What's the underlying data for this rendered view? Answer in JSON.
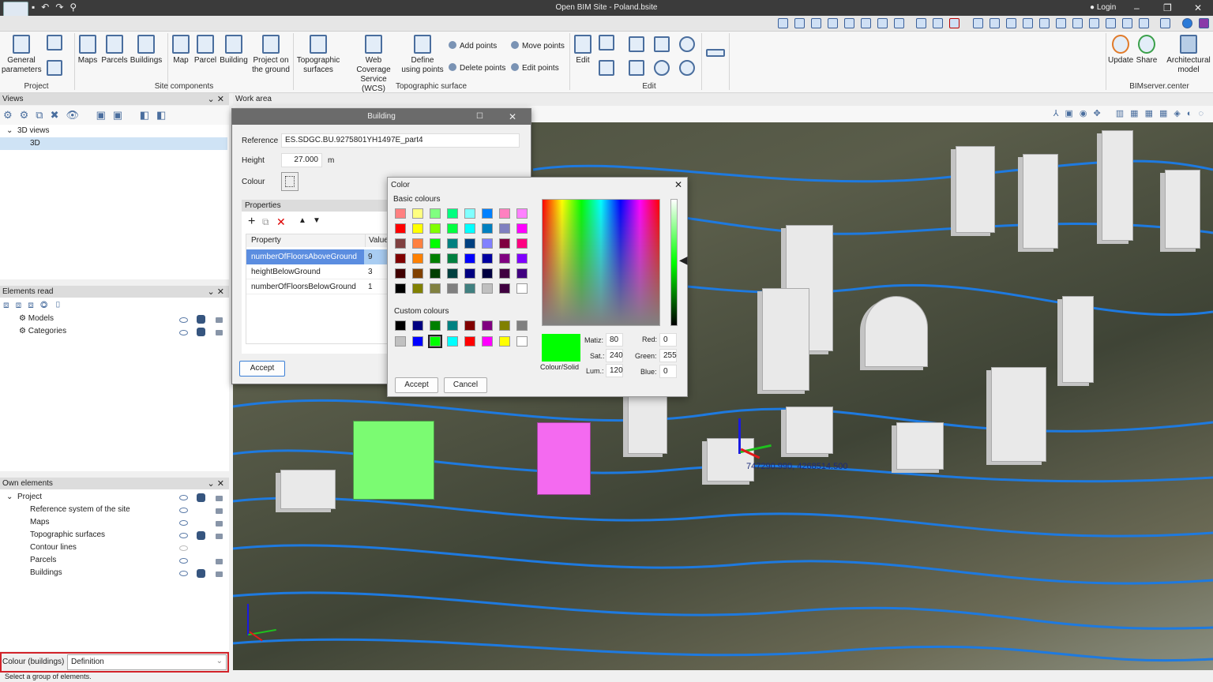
{
  "app": {
    "title": "Open BIM Site - Poland.bsite",
    "login": "Login",
    "minimize": "–",
    "restore": "❐",
    "close": "✕"
  },
  "ribbon": {
    "project": {
      "general_parameters": "General parameters",
      "group": "Project"
    },
    "site": {
      "maps": "Maps",
      "parcels": "Parcels",
      "buildings": "Buildings",
      "map": "Map",
      "parcel": "Parcel",
      "building": "Building",
      "project_on_ground": "Project on the ground",
      "group": "Site components"
    },
    "topo": {
      "topographic_surfaces": "Topographic surfaces",
      "wcs": "Web Coverage Service (WCS)",
      "define_points": "Define using points",
      "add_points": "Add points",
      "move_points": "Move points",
      "delete_points": "Delete points",
      "edit_points": "Edit points",
      "group": "Topographic surface"
    },
    "edit": {
      "edit": "Edit",
      "group": "Edit"
    },
    "bim": {
      "update": "Update",
      "share": "Share",
      "architectural_model": "Architectural model",
      "group": "BIMserver.center"
    }
  },
  "views": {
    "title": "Views",
    "tree": [
      {
        "label": "3D views"
      },
      {
        "label": "3D",
        "selected": true
      }
    ]
  },
  "elements_read": {
    "title": "Elements read",
    "items": [
      {
        "label": "Models"
      },
      {
        "label": "Categories"
      }
    ]
  },
  "own_elements": {
    "title": "Own elements",
    "root": "Project",
    "items": [
      {
        "label": "Reference system of the site",
        "eye": true,
        "cube": false,
        "lock": true
      },
      {
        "label": "Maps",
        "eye": true,
        "cube": false,
        "lock": true
      },
      {
        "label": "Topographic surfaces",
        "eye": true,
        "cube": true,
        "lock": true
      },
      {
        "label": "Contour lines",
        "eye": false,
        "cube": false,
        "lock": false
      },
      {
        "label": "Parcels",
        "eye": true,
        "cube": false,
        "lock": true
      },
      {
        "label": "Buildings",
        "eye": true,
        "cube": true,
        "lock": true
      }
    ]
  },
  "colour_buildings": {
    "label": "Colour (buildings)",
    "value": "Definition"
  },
  "status": "Select a group of elements.",
  "work_area": {
    "title": "Work area",
    "coordinates": "747290.990, 4268514.500"
  },
  "building_dialog": {
    "title": "Building",
    "reference_label": "Reference",
    "reference": "ES.SDGC.BU.9275801YH1497E_part4",
    "height_label": "Height",
    "height": "27.000",
    "height_unit": "m",
    "colour_label": "Colour",
    "properties_title": "Properties",
    "col_property": "Property",
    "col_value": "Value",
    "rows": [
      {
        "property": "numberOfFloorsAboveGround",
        "value": "9",
        "selected": true
      },
      {
        "property": "heightBelowGround",
        "value": "3"
      },
      {
        "property": "numberOfFloorsBelowGround",
        "value": "1"
      }
    ],
    "accept": "Accept"
  },
  "color_dialog": {
    "title": "Color",
    "basic_label": "Basic colours",
    "custom_label": "Custom colours",
    "basic": [
      "#ff8080",
      "#ffff80",
      "#80ff80",
      "#00ff80",
      "#80ffff",
      "#0080ff",
      "#ff80c0",
      "#ff80ff",
      "#ff0000",
      "#ffff00",
      "#80ff00",
      "#00ff40",
      "#00ffff",
      "#0080c0",
      "#8080c0",
      "#ff00ff",
      "#804040",
      "#ff8040",
      "#00ff00",
      "#008080",
      "#004080",
      "#8080ff",
      "#800040",
      "#ff0080",
      "#800000",
      "#ff8000",
      "#008000",
      "#008040",
      "#0000ff",
      "#0000a0",
      "#800080",
      "#8000ff",
      "#400000",
      "#804000",
      "#004000",
      "#004040",
      "#000080",
      "#000040",
      "#400040",
      "#400080",
      "#000000",
      "#808000",
      "#808040",
      "#808080",
      "#408080",
      "#c0c0c0",
      "#400040",
      "#ffffff"
    ],
    "custom": [
      "#000000",
      "#000080",
      "#008000",
      "#008080",
      "#800000",
      "#800080",
      "#808000",
      "#808080",
      "#c0c0c0",
      "#0000ff",
      "#00ff00",
      "#00ffff",
      "#ff0000",
      "#ff00ff",
      "#ffff00",
      "#ffffff"
    ],
    "selected_custom": 10,
    "current_color": "#00ff00",
    "colour_solid": "Colour/Solid",
    "hue_label": "Matiz:",
    "hue": "80",
    "sat_label": "Sat.:",
    "sat": "240",
    "lum_label": "Lum.:",
    "lum": "120",
    "red_label": "Red:",
    "red": "0",
    "green_label": "Green:",
    "green": "255",
    "blue_label": "Blue:",
    "blue": "0",
    "accept": "Accept",
    "cancel": "Cancel"
  }
}
